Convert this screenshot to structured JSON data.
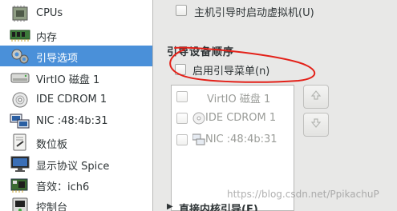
{
  "sidebar": {
    "items": [
      {
        "label": "CPUs",
        "icon": "cpu-icon"
      },
      {
        "label": "内存",
        "icon": "memory-icon"
      },
      {
        "label": "引导选项",
        "icon": "boot-options-icon",
        "selected": true
      },
      {
        "label": "VirtIO 磁盘 1",
        "icon": "disk-icon"
      },
      {
        "label": "IDE CDROM 1",
        "icon": "cdrom-icon"
      },
      {
        "label": "NIC :48:4b:31",
        "icon": "network-icon"
      },
      {
        "label": "数位板",
        "icon": "tablet-icon"
      },
      {
        "label": "显示协议 Spice",
        "icon": "display-icon"
      },
      {
        "label": "音效：ich6",
        "icon": "sound-icon"
      },
      {
        "label": "控制台",
        "icon": "console-icon"
      }
    ]
  },
  "autostart": {
    "label": "主机引导时启动虚拟机(U)",
    "checked": false
  },
  "boot_order": {
    "title": "引导设备顺序",
    "enable_menu_label": "启用引导菜单(n)",
    "enable_menu_checked": false,
    "devices": [
      {
        "label": "VirtIO 磁盘 1",
        "icon": "disk-icon",
        "checked": false
      },
      {
        "label": "IDE CDROM 1",
        "icon": "cdrom-icon",
        "checked": false
      },
      {
        "label": "NIC :48:4b:31",
        "icon": "network-icon",
        "checked": false
      }
    ],
    "move_up": "arrow-up-icon",
    "move_down": "arrow-down-icon"
  },
  "direct_kernel_boot": {
    "label": "直接内核引导(E)",
    "expanded": false
  },
  "watermark": "https://blog.csdn.net/PpikachuP",
  "colors": {
    "selection": "#4a90d9",
    "annotation": "#e32119"
  }
}
